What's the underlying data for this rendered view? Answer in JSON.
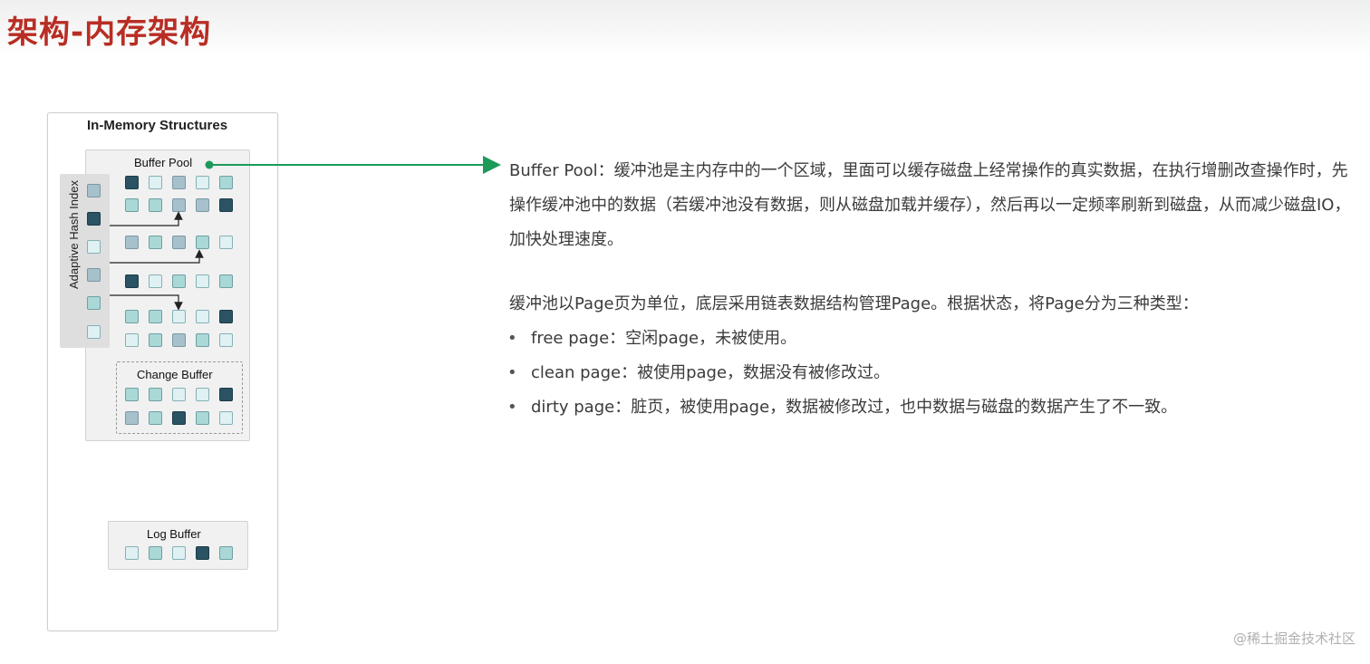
{
  "page_title": "架构-内存架构",
  "diagram": {
    "title": "In-Memory Structures",
    "buffer_pool_label": "Buffer Pool",
    "adaptive_hash_index_label": "Adaptive Hash Index",
    "change_buffer_label": "Change Buffer",
    "log_buffer_label": "Log Buffer",
    "colors": {
      "light": "#dff1f3",
      "teal": "#a9d8d6",
      "grey_blue": "#a7c1cc",
      "dark": "#2a5364",
      "arrow_green": "#1d9a5a",
      "title_red": "#b82d24"
    }
  },
  "description": {
    "buffer_pool": "Buffer Pool：缓冲池是主内存中的一个区域，里面可以缓存磁盘上经常操作的真实数据，在执行增删改查操作时，先操作缓冲池中的数据（若缓冲池没有数据，则从磁盘加载并缓存），然后再以一定频率刷新到磁盘，从而减少磁盘IO，加快处理速度。",
    "page_intro": "缓冲池以Page页为单位，底层采用链表数据结构管理Page。根据状态，将Page分为三种类型：",
    "page_types": [
      "free page：空闲page，未被使用。",
      "clean page：被使用page，数据没有被修改过。",
      "dirty page：脏页，被使用page，数据被修改过，也中数据与磁盘的数据产生了不一致。"
    ],
    "bullet": "•"
  },
  "watermark": "@稀土掘金技术社区"
}
